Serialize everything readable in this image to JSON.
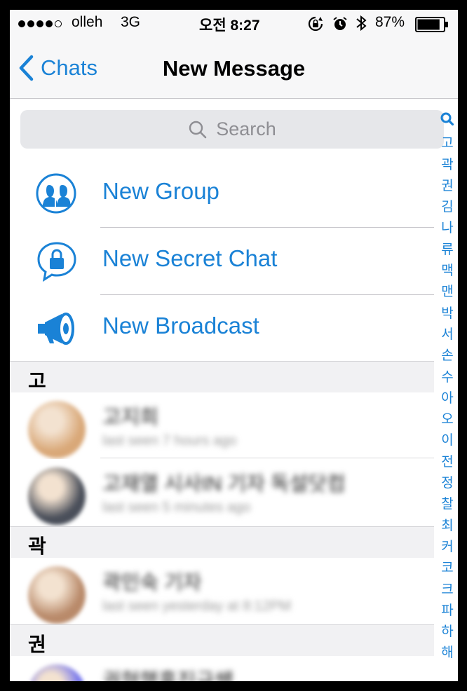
{
  "status_bar": {
    "carrier": "olleh",
    "network": "3G",
    "time": "오전 8:27",
    "battery_percent": "87%",
    "battery_level": 0.87,
    "signal_bars_filled": 4,
    "signal_bars_total": 5
  },
  "nav": {
    "back_label": "Chats",
    "title": "New Message"
  },
  "search": {
    "placeholder": "Search"
  },
  "actions": [
    {
      "label": "New Group",
      "icon": "group-icon"
    },
    {
      "label": "New Secret Chat",
      "icon": "secret-chat-lock-icon"
    },
    {
      "label": "New Broadcast",
      "icon": "megaphone-icon"
    }
  ],
  "sections": [
    {
      "title": "고",
      "contacts": [
        {
          "name": "고지희",
          "status": "last seen 7 hours ago",
          "avatar_color": "#d9a878"
        },
        {
          "name": "고재열 시사IN 기자 독설닷컴",
          "status": "last seen 5 minutes ago",
          "avatar_color": "#4a4f5a"
        }
      ]
    },
    {
      "title": "곽",
      "contacts": [
        {
          "name": "곽민숙 기자",
          "status": "last seen yesterday at 8:12PM",
          "avatar_color": "#b98a6a"
        }
      ]
    },
    {
      "title": "권",
      "contacts": [
        {
          "name": "권혁행홍진규쌤",
          "status": "",
          "avatar_color": "#6a6cf0"
        }
      ]
    }
  ],
  "index": [
    "search-icon",
    "고",
    "곽",
    "권",
    "김",
    "나",
    "류",
    "맥",
    "맨",
    "박",
    "서",
    "손",
    "수",
    "아",
    "오",
    "이",
    "전",
    "정",
    "찰",
    "최",
    "커",
    "코",
    "크",
    "파",
    "하",
    "해"
  ],
  "colors": {
    "accent": "#1a82d6",
    "bar_bg": "#f7f7f8",
    "search_bg": "#e6e7ea",
    "section_bg": "#f1f1f3"
  }
}
